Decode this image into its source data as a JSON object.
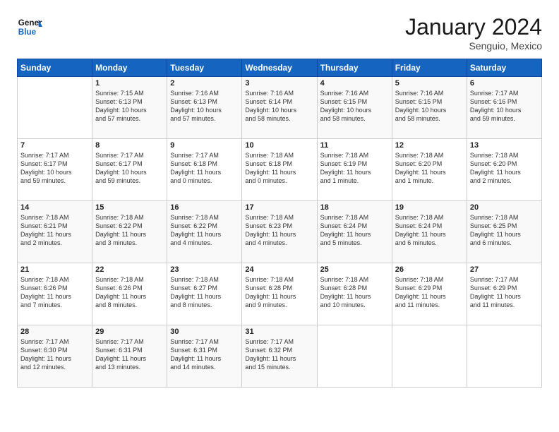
{
  "header": {
    "logo_line1": "General",
    "logo_line2": "Blue",
    "title": "January 2024",
    "subtitle": "Senguio, Mexico"
  },
  "days_of_week": [
    "Sunday",
    "Monday",
    "Tuesday",
    "Wednesday",
    "Thursday",
    "Friday",
    "Saturday"
  ],
  "weeks": [
    [
      {
        "num": "",
        "info": ""
      },
      {
        "num": "1",
        "info": "Sunrise: 7:15 AM\nSunset: 6:13 PM\nDaylight: 10 hours\nand 57 minutes."
      },
      {
        "num": "2",
        "info": "Sunrise: 7:16 AM\nSunset: 6:13 PM\nDaylight: 10 hours\nand 57 minutes."
      },
      {
        "num": "3",
        "info": "Sunrise: 7:16 AM\nSunset: 6:14 PM\nDaylight: 10 hours\nand 58 minutes."
      },
      {
        "num": "4",
        "info": "Sunrise: 7:16 AM\nSunset: 6:15 PM\nDaylight: 10 hours\nand 58 minutes."
      },
      {
        "num": "5",
        "info": "Sunrise: 7:16 AM\nSunset: 6:15 PM\nDaylight: 10 hours\nand 58 minutes."
      },
      {
        "num": "6",
        "info": "Sunrise: 7:17 AM\nSunset: 6:16 PM\nDaylight: 10 hours\nand 59 minutes."
      }
    ],
    [
      {
        "num": "7",
        "info": "Sunrise: 7:17 AM\nSunset: 6:17 PM\nDaylight: 10 hours\nand 59 minutes."
      },
      {
        "num": "8",
        "info": "Sunrise: 7:17 AM\nSunset: 6:17 PM\nDaylight: 10 hours\nand 59 minutes."
      },
      {
        "num": "9",
        "info": "Sunrise: 7:17 AM\nSunset: 6:18 PM\nDaylight: 11 hours\nand 0 minutes."
      },
      {
        "num": "10",
        "info": "Sunrise: 7:18 AM\nSunset: 6:18 PM\nDaylight: 11 hours\nand 0 minutes."
      },
      {
        "num": "11",
        "info": "Sunrise: 7:18 AM\nSunset: 6:19 PM\nDaylight: 11 hours\nand 1 minute."
      },
      {
        "num": "12",
        "info": "Sunrise: 7:18 AM\nSunset: 6:20 PM\nDaylight: 11 hours\nand 1 minute."
      },
      {
        "num": "13",
        "info": "Sunrise: 7:18 AM\nSunset: 6:20 PM\nDaylight: 11 hours\nand 2 minutes."
      }
    ],
    [
      {
        "num": "14",
        "info": "Sunrise: 7:18 AM\nSunset: 6:21 PM\nDaylight: 11 hours\nand 2 minutes."
      },
      {
        "num": "15",
        "info": "Sunrise: 7:18 AM\nSunset: 6:22 PM\nDaylight: 11 hours\nand 3 minutes."
      },
      {
        "num": "16",
        "info": "Sunrise: 7:18 AM\nSunset: 6:22 PM\nDaylight: 11 hours\nand 4 minutes."
      },
      {
        "num": "17",
        "info": "Sunrise: 7:18 AM\nSunset: 6:23 PM\nDaylight: 11 hours\nand 4 minutes."
      },
      {
        "num": "18",
        "info": "Sunrise: 7:18 AM\nSunset: 6:24 PM\nDaylight: 11 hours\nand 5 minutes."
      },
      {
        "num": "19",
        "info": "Sunrise: 7:18 AM\nSunset: 6:24 PM\nDaylight: 11 hours\nand 6 minutes."
      },
      {
        "num": "20",
        "info": "Sunrise: 7:18 AM\nSunset: 6:25 PM\nDaylight: 11 hours\nand 6 minutes."
      }
    ],
    [
      {
        "num": "21",
        "info": "Sunrise: 7:18 AM\nSunset: 6:26 PM\nDaylight: 11 hours\nand 7 minutes."
      },
      {
        "num": "22",
        "info": "Sunrise: 7:18 AM\nSunset: 6:26 PM\nDaylight: 11 hours\nand 8 minutes."
      },
      {
        "num": "23",
        "info": "Sunrise: 7:18 AM\nSunset: 6:27 PM\nDaylight: 11 hours\nand 8 minutes."
      },
      {
        "num": "24",
        "info": "Sunrise: 7:18 AM\nSunset: 6:28 PM\nDaylight: 11 hours\nand 9 minutes."
      },
      {
        "num": "25",
        "info": "Sunrise: 7:18 AM\nSunset: 6:28 PM\nDaylight: 11 hours\nand 10 minutes."
      },
      {
        "num": "26",
        "info": "Sunrise: 7:18 AM\nSunset: 6:29 PM\nDaylight: 11 hours\nand 11 minutes."
      },
      {
        "num": "27",
        "info": "Sunrise: 7:17 AM\nSunset: 6:29 PM\nDaylight: 11 hours\nand 11 minutes."
      }
    ],
    [
      {
        "num": "28",
        "info": "Sunrise: 7:17 AM\nSunset: 6:30 PM\nDaylight: 11 hours\nand 12 minutes."
      },
      {
        "num": "29",
        "info": "Sunrise: 7:17 AM\nSunset: 6:31 PM\nDaylight: 11 hours\nand 13 minutes."
      },
      {
        "num": "30",
        "info": "Sunrise: 7:17 AM\nSunset: 6:31 PM\nDaylight: 11 hours\nand 14 minutes."
      },
      {
        "num": "31",
        "info": "Sunrise: 7:17 AM\nSunset: 6:32 PM\nDaylight: 11 hours\nand 15 minutes."
      },
      {
        "num": "",
        "info": ""
      },
      {
        "num": "",
        "info": ""
      },
      {
        "num": "",
        "info": ""
      }
    ]
  ]
}
